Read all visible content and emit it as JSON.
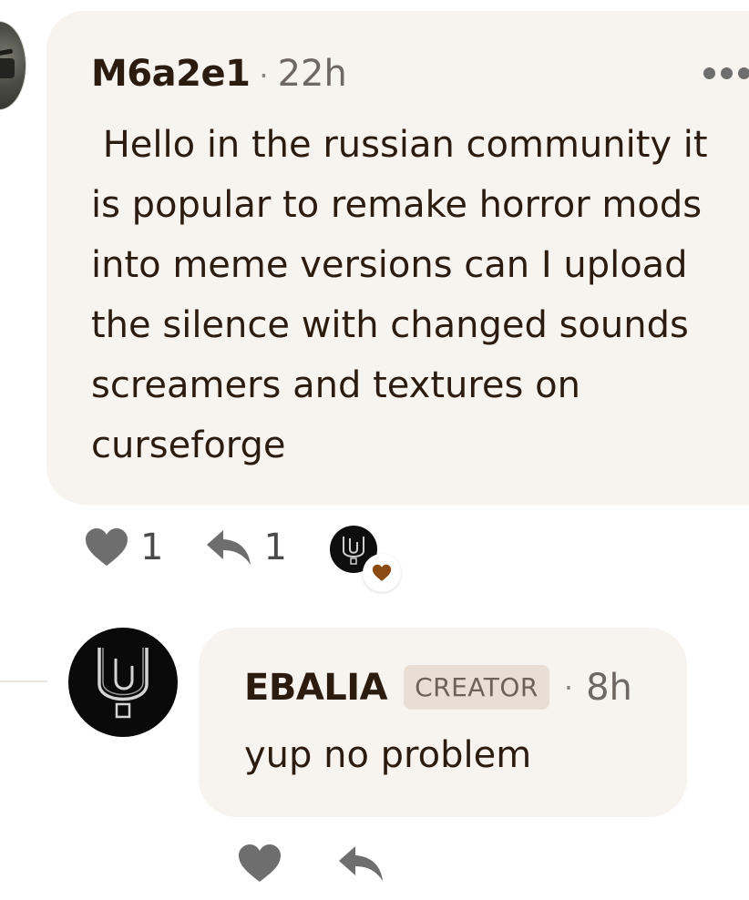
{
  "comment": {
    "author": "M6a2e1",
    "separator": "·",
    "time": "22h",
    "text": " Hello in the russian community it\nis popular to remake horror mods\ninto meme versions can I upload\nthe silence with changed sounds\nscreamers and textures on\ncurseforge",
    "likes": "1",
    "replies": "1"
  },
  "reply": {
    "author": "EBALIA",
    "badge": "CREATOR",
    "separator": "·",
    "time": "8h",
    "text": "yup no problem"
  },
  "colors": {
    "bubble": "#f7f4ef",
    "text": "#2c1c0f",
    "icon": "#6e6e6e",
    "badge_bg": "#e8ded4",
    "creator_heart": "#8b4a12"
  },
  "icons": {
    "like": "heart-icon",
    "reply": "reply-arrow-icon",
    "more": "more-dots-icon",
    "creator_liked": "heart-icon"
  }
}
